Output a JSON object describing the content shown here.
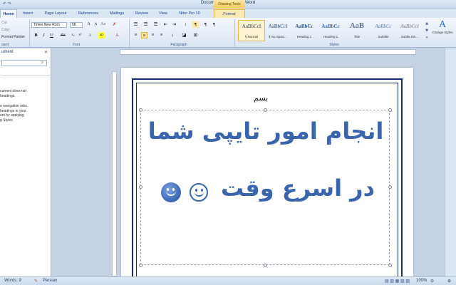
{
  "window": {
    "title": "Document5 - Microsoft Word",
    "contextual_tab": "Drawing Tools"
  },
  "tabs": [
    "Home",
    "Insert",
    "Page Layout",
    "References",
    "Mailings",
    "Review",
    "View",
    "Nitro Pro 10",
    "Format"
  ],
  "clipboard": {
    "cut": "Cut",
    "copy": "Copy",
    "format_painter": "Format Painter",
    "label": "oard"
  },
  "font": {
    "name": "Times New Rom",
    "size": "58",
    "label": "Font"
  },
  "paragraph": {
    "label": "Paragraph"
  },
  "styles": {
    "label": "Styles",
    "items": [
      {
        "sample": "AaBbCcI",
        "name": "¶ Normal"
      },
      {
        "sample": "AaBbCcI",
        "name": "¶ No Spaci..."
      },
      {
        "sample": "AaBbCc",
        "name": "Heading 1"
      },
      {
        "sample": "AaBbCc",
        "name": "Heading 2"
      },
      {
        "sample": "AaB",
        "name": "Title"
      },
      {
        "sample": "AaBbCc",
        "name": "Subtitle"
      },
      {
        "sample": "AaBbCcI",
        "name": "Subtle Em..."
      }
    ],
    "change_styles": "Change Styles"
  },
  "nav": {
    "title": "ument",
    "search_placeholder": "",
    "msg1": "cument does not\n headings.",
    "msg2": "e navigation tabs,\n headings in your\nent by applying\ng Styles."
  },
  "document": {
    "line1": "انجام امور تایپی شما",
    "line2": "در اسرع وقت",
    "signature": "بسم"
  },
  "status": {
    "words": "Words: 9",
    "language": "Persian",
    "zoom": "100%"
  }
}
